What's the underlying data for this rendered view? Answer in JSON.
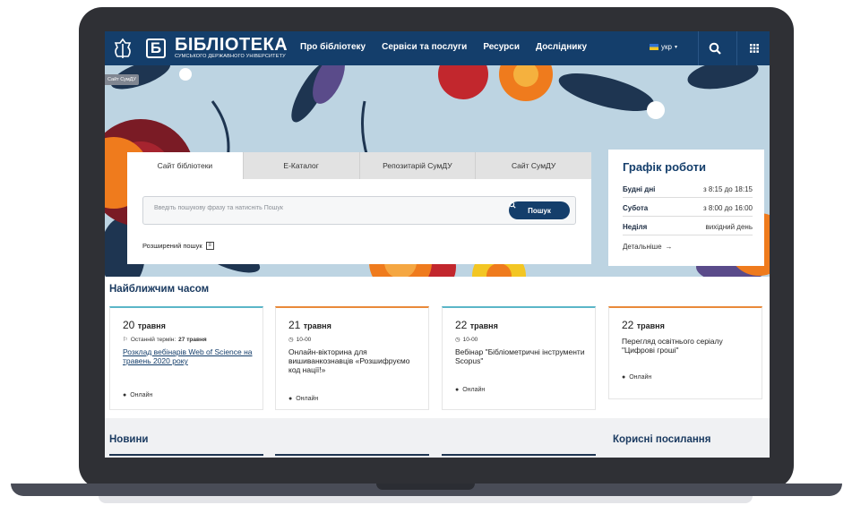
{
  "header": {
    "logo_letter": "Б",
    "logo_title": "БІБЛІОТЕКА",
    "logo_subtitle": "СУМСЬКОГО ДЕРЖАВНОГО УНІВЕРСИТЕТУ",
    "nav": [
      "Про бібліотеку",
      "Сервіси та послуги",
      "Ресурси",
      "Досліднику"
    ],
    "language": "укр",
    "colors": {
      "bar": "#143e6b",
      "accent": "#f3c623"
    },
    "icons": [
      "crest-icon",
      "search-icon",
      "grid-icon",
      "caret-down-icon"
    ]
  },
  "badge": "Сайт СумДУ",
  "search_panel": {
    "tabs": [
      "Сайт бібліотеки",
      "Е-Каталог",
      "Репозитарій СумДУ",
      "Сайт СумДУ"
    ],
    "active_tab": 0,
    "placeholder": "Введіть пошукову фразу та натисніть Пошук",
    "button": "Пошук",
    "advanced": "Розширений пошук"
  },
  "schedule": {
    "title": "Графік роботи",
    "rows": [
      {
        "day": "Будні дні",
        "time": "з 8:15 до 18:15"
      },
      {
        "day": "Субота",
        "time": "з 8:00 до 16:00"
      },
      {
        "day": "Неділя",
        "time": "вихідний день"
      }
    ],
    "more": "Детальніше"
  },
  "upcoming": {
    "title": "Найближчим часом",
    "cards": [
      {
        "day": "20",
        "month": "травня",
        "meta_label": "Останній термін:",
        "meta_value": "27 травня",
        "title": "Розклад вебінарів Web of Science на травень 2020 року",
        "location": "Онлайн",
        "accent": "#5bb6c8"
      },
      {
        "day": "21",
        "month": "травня",
        "meta_label": "10-00",
        "meta_value": "",
        "title": "Онлайн-вікторина для вишиванкознавців «Розшифруємо код нації!»",
        "location": "Онлайн",
        "accent": "#e98a3a"
      },
      {
        "day": "22",
        "month": "травня",
        "meta_label": "10-00",
        "meta_value": "",
        "title": "Вебінар \"Бібліометричні інструменти Scopus\"",
        "location": "Онлайн",
        "accent": "#5bb6c8"
      },
      {
        "day": "22",
        "month": "травня",
        "meta_label": "",
        "meta_value": "",
        "title": "Перегляд освітнього серіалу \"Цифрові гроші\"",
        "location": "Онлайн",
        "accent": "#e98a3a"
      }
    ]
  },
  "news_title": "Новини",
  "links_title": "Корисні посилання"
}
